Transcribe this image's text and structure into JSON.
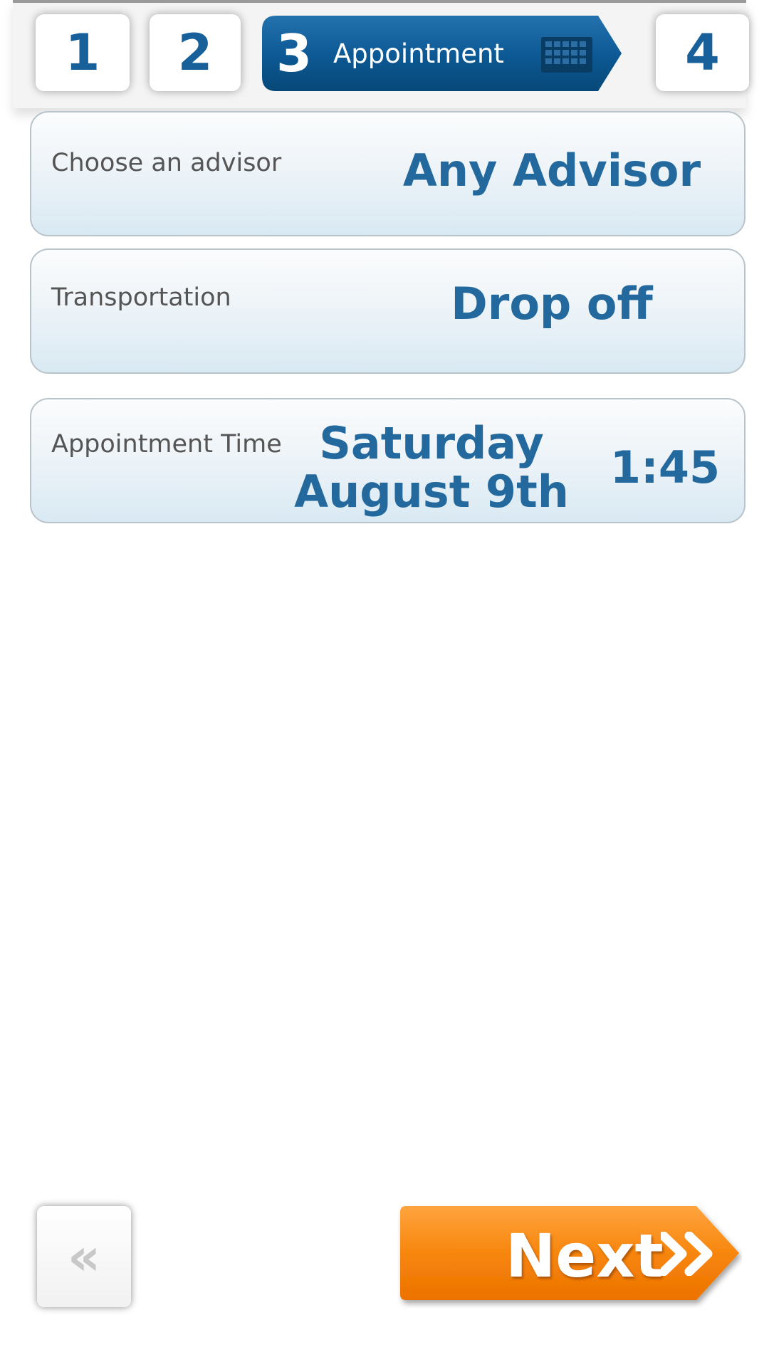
{
  "steps": {
    "step1": "1",
    "step2": "2",
    "step3_number": "3",
    "step3_label": "Appointment",
    "step4": "4",
    "current_step": 3
  },
  "advisor": {
    "label": "Choose an advisor",
    "value": "Any Advisor"
  },
  "transportation": {
    "label": "Transportation",
    "value": "Drop off"
  },
  "appointment_time": {
    "label": "Appointment Time",
    "day": "Saturday",
    "date": "August 9th",
    "time": "1:45"
  },
  "nav": {
    "back_label": "«",
    "next_label": "Next"
  },
  "icons": {
    "calendar": "calendar-icon",
    "next_arrows": "double-chevron-right-icon",
    "back_arrows": "double-chevron-left-icon"
  },
  "colors": {
    "primary_blue": "#17609a",
    "value_blue": "#23699e",
    "active_step_bg": "#0e5690",
    "next_orange": "#f47c00",
    "label_gray": "#555555"
  }
}
